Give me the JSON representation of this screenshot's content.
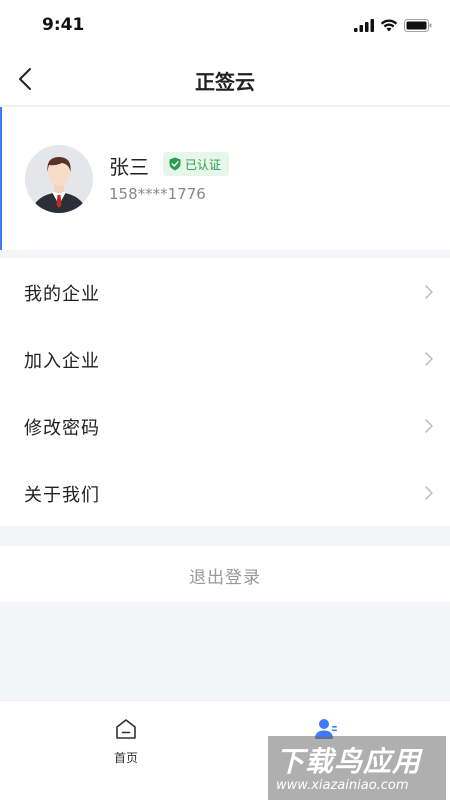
{
  "status_bar": {
    "time": "9:41"
  },
  "nav": {
    "title": "正签云"
  },
  "profile": {
    "name": "张三",
    "verified_label": "已认证",
    "phone": "158****1776"
  },
  "menu": {
    "items": [
      {
        "label": "我的企业"
      },
      {
        "label": "加入企业"
      },
      {
        "label": "修改密码"
      },
      {
        "label": "关于我们"
      }
    ]
  },
  "logout": {
    "label": "退出登录"
  },
  "tabs": [
    {
      "label": "首页"
    },
    {
      "label": ""
    }
  ],
  "colors": {
    "accent": "#3d7bf7",
    "verified_green": "#2c9e4b",
    "background": "#f4f5f9"
  },
  "watermark": {
    "main": "下载鸟应用",
    "sub": "www.xiazainiao.com"
  }
}
